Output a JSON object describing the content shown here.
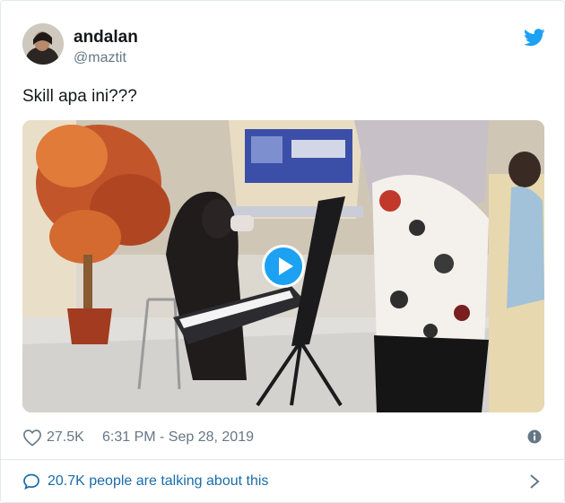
{
  "tweet": {
    "display_name": "andalan",
    "handle": "@maztit",
    "text": "Skill apa ini???",
    "likes": "27.5K",
    "timestamp": "6:31 PM - Sep 28, 2019",
    "conversation": "20.7K people are talking about this"
  },
  "icons": {
    "logo": "twitter-bird-icon",
    "like": "heart-outline-icon",
    "info": "info-circle-icon",
    "conversation": "speech-bubble-icon",
    "chevron": "chevron-right-icon",
    "play": "play-icon"
  },
  "colors": {
    "brand": "#1da1f2",
    "text": "#14171a",
    "muted": "#657786",
    "link": "#1b6ca8",
    "border": "#e1e8ed"
  }
}
